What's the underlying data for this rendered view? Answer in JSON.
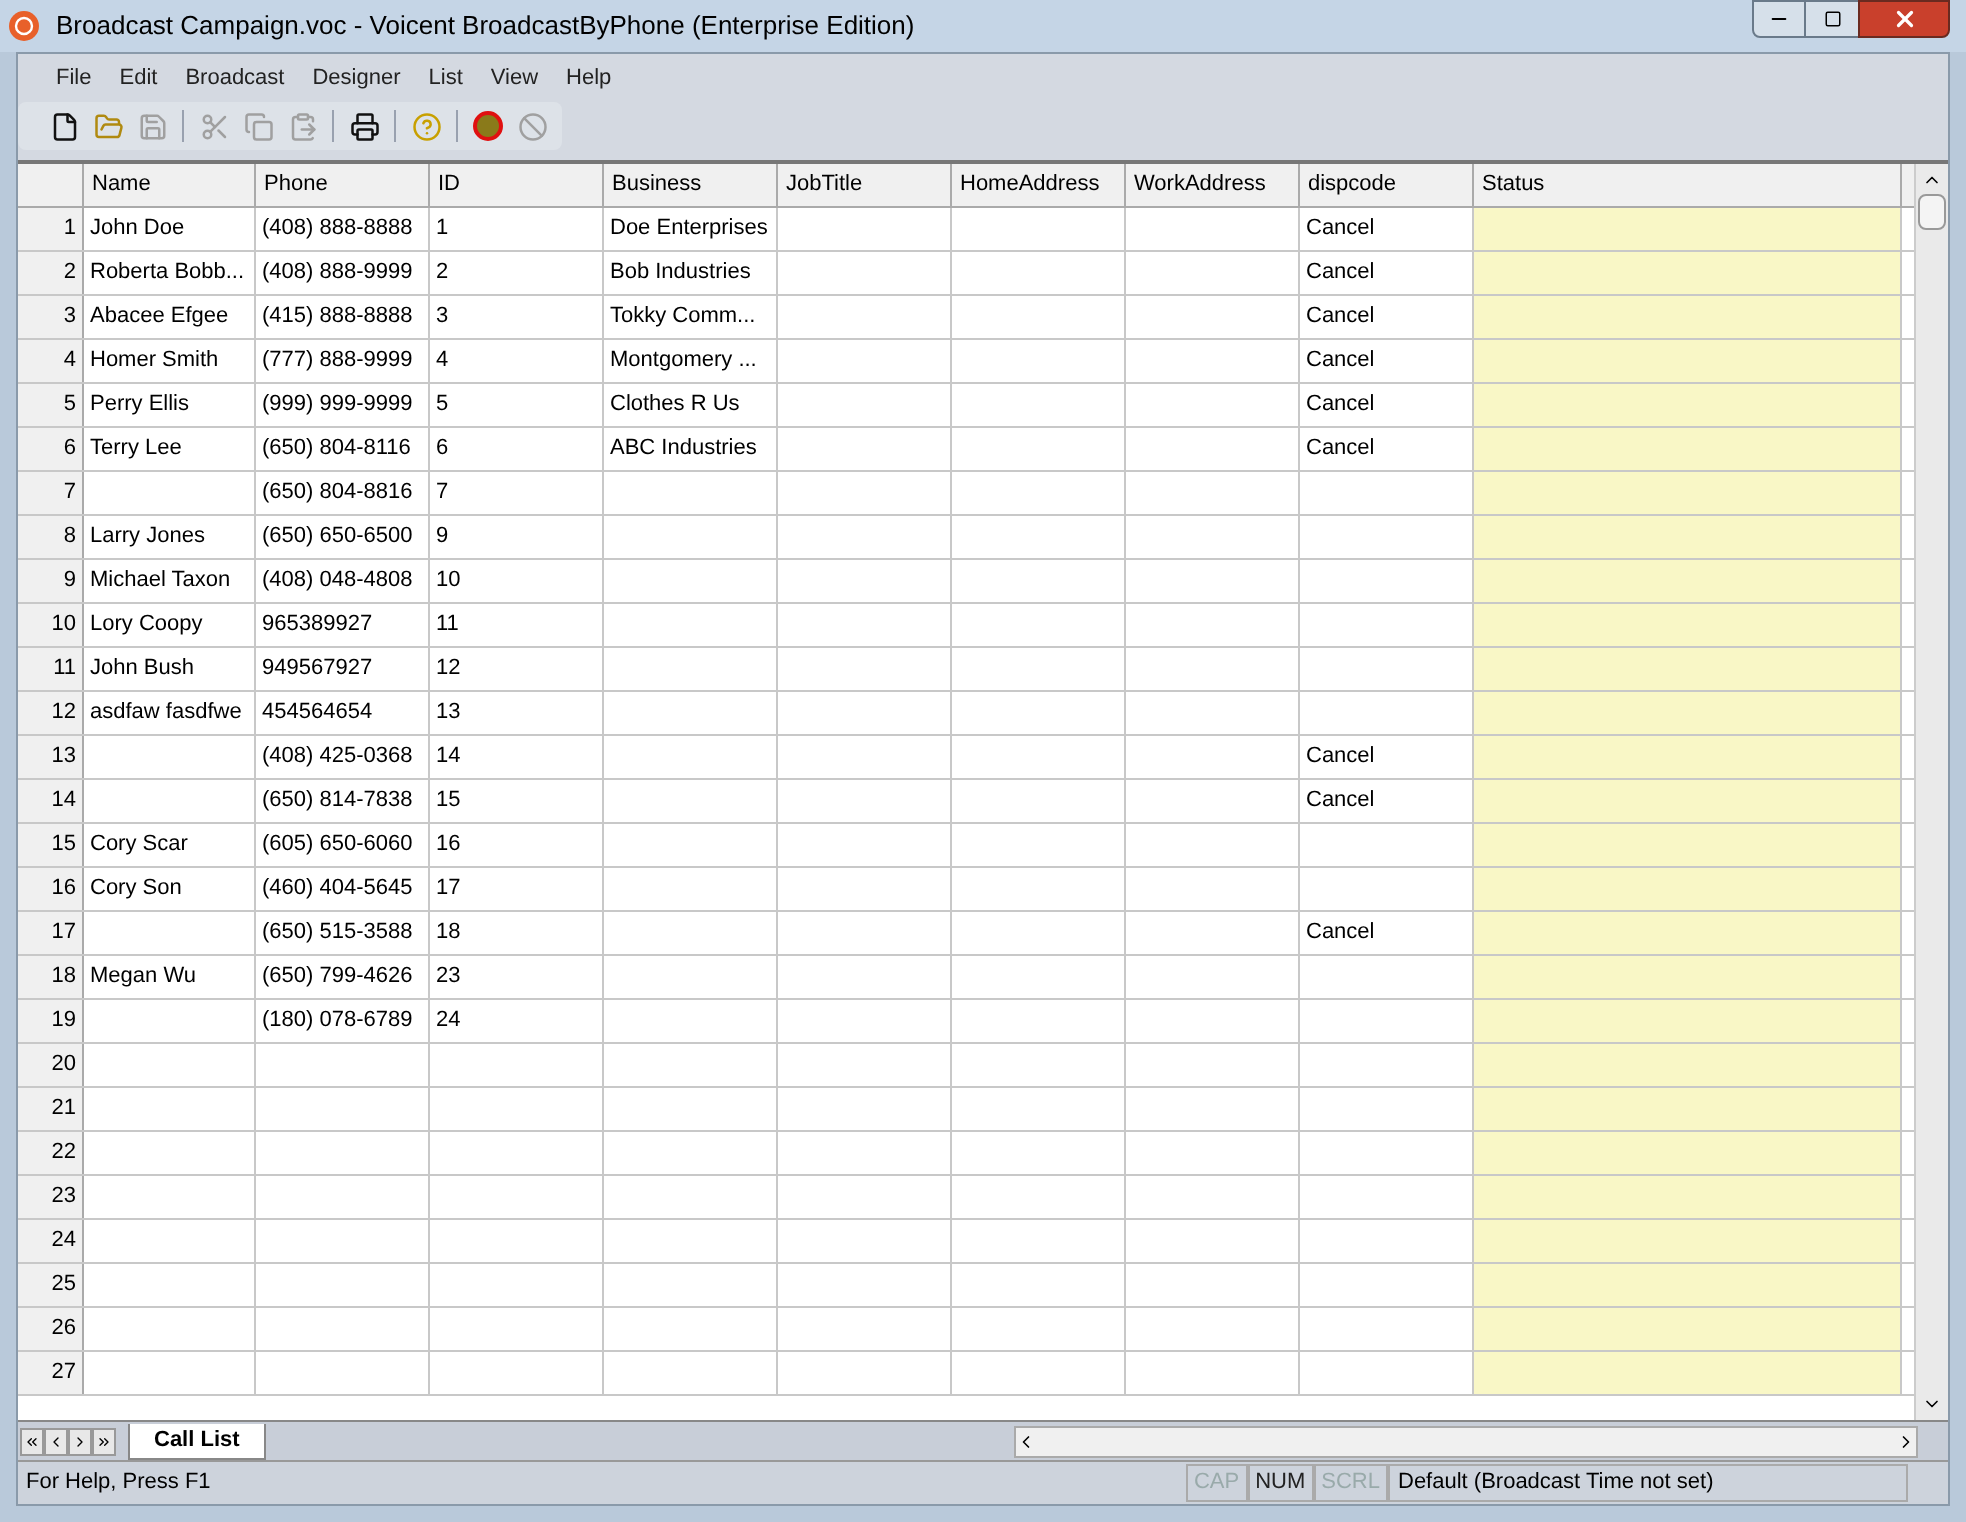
{
  "window": {
    "title": "Broadcast Campaign.voc - Voicent BroadcastByPhone (Enterprise Edition)"
  },
  "menu": [
    "File",
    "Edit",
    "Broadcast",
    "Designer",
    "List",
    "View",
    "Help"
  ],
  "toolbar": [
    {
      "kind": "new",
      "disabled": false
    },
    {
      "kind": "open",
      "disabled": false
    },
    {
      "kind": "save",
      "disabled": true
    },
    {
      "kind": "sep"
    },
    {
      "kind": "cut",
      "disabled": true
    },
    {
      "kind": "copy",
      "disabled": true
    },
    {
      "kind": "paste",
      "disabled": true
    },
    {
      "kind": "sep"
    },
    {
      "kind": "print",
      "disabled": false
    },
    {
      "kind": "sep"
    },
    {
      "kind": "help",
      "disabled": false
    },
    {
      "kind": "sep"
    },
    {
      "kind": "start",
      "disabled": false
    },
    {
      "kind": "stop",
      "disabled": true
    }
  ],
  "table": {
    "columns": [
      "Name",
      "Phone",
      "ID",
      "Business",
      "JobTitle",
      "HomeAddress",
      "WorkAddress",
      "dispcode",
      "Status"
    ],
    "rows": [
      {
        "number": "1",
        "cells": [
          "John Doe",
          "(408) 888-8888",
          "1",
          "Doe Enterprises",
          null,
          null,
          null,
          "Cancel"
        ]
      },
      {
        "number": "2",
        "cells": [
          "Roberta Bobb...",
          "(408) 888-9999",
          "2",
          "Bob Industries",
          null,
          null,
          null,
          "Cancel"
        ]
      },
      {
        "number": "3",
        "cells": [
          "Abacee Efgee",
          "(415) 888-8888",
          "3",
          "Tokky Comm...",
          null,
          null,
          null,
          "Cancel"
        ]
      },
      {
        "number": "4",
        "cells": [
          "Homer Smith",
          "(777) 888-9999",
          "4",
          "Montgomery ...",
          null,
          null,
          null,
          "Cancel"
        ]
      },
      {
        "number": "5",
        "cells": [
          "Perry Ellis",
          "(999) 999-9999",
          "5",
          "Clothes R Us",
          null,
          null,
          null,
          "Cancel"
        ]
      },
      {
        "number": "6",
        "cells": [
          "Terry Lee",
          "(650) 804-8116",
          "6",
          "ABC Industries",
          null,
          null,
          null,
          "Cancel"
        ]
      },
      {
        "number": "7",
        "cells": [
          null,
          "(650) 804-8816",
          "7"
        ]
      },
      {
        "number": "8",
        "cells": [
          "Larry Jones",
          "(650) 650-6500",
          "9"
        ]
      },
      {
        "number": "9",
        "cells": [
          "Michael Taxon",
          "(408) 048-4808",
          "10"
        ]
      },
      {
        "number": "10",
        "cells": [
          "Lory Coopy",
          "965389927",
          "11"
        ]
      },
      {
        "number": "11",
        "cells": [
          "John Bush",
          "949567927",
          "12"
        ]
      },
      {
        "number": "12",
        "cells": [
          "asdfaw fasdfwe",
          "454564654",
          "13"
        ]
      },
      {
        "number": "13",
        "cells": [
          null,
          "(408) 425-0368",
          "14",
          null,
          null,
          null,
          null,
          "Cancel"
        ]
      },
      {
        "number": "14",
        "cells": [
          null,
          "(650) 814-7838",
          "15",
          null,
          null,
          null,
          null,
          "Cancel"
        ]
      },
      {
        "number": "15",
        "cells": [
          "Cory Scar",
          "(605) 650-6060",
          "16"
        ]
      },
      {
        "number": "16",
        "cells": [
          "Cory Son",
          "(460) 404-5645",
          "17"
        ]
      },
      {
        "number": "17",
        "cells": [
          null,
          "(650) 515-3588",
          "18",
          null,
          null,
          null,
          null,
          "Cancel"
        ]
      },
      {
        "number": "18",
        "cells": [
          "Megan Wu",
          "(650) 799-4626",
          "23"
        ]
      },
      {
        "number": "19",
        "cells": [
          null,
          "(180) 078-6789",
          "24"
        ]
      },
      {
        "number": "20",
        "cells": []
      },
      {
        "number": "21",
        "cells": []
      },
      {
        "number": "22",
        "cells": []
      },
      {
        "number": "23",
        "cells": []
      },
      {
        "number": "24",
        "cells": []
      },
      {
        "number": "25",
        "cells": []
      },
      {
        "number": "26",
        "cells": []
      },
      {
        "number": "27",
        "cells": []
      }
    ]
  },
  "sheet_tabs": [
    {
      "label": "Call List",
      "selected": true
    }
  ],
  "status_bar": {
    "message": "For Help, Press F1",
    "indicators": [
      {
        "label": "CAP",
        "on": false
      },
      {
        "label": "NUM",
        "on": true
      },
      {
        "label": "SCRL",
        "on": false
      }
    ],
    "schedule": "Default (Broadcast Time not set)"
  }
}
